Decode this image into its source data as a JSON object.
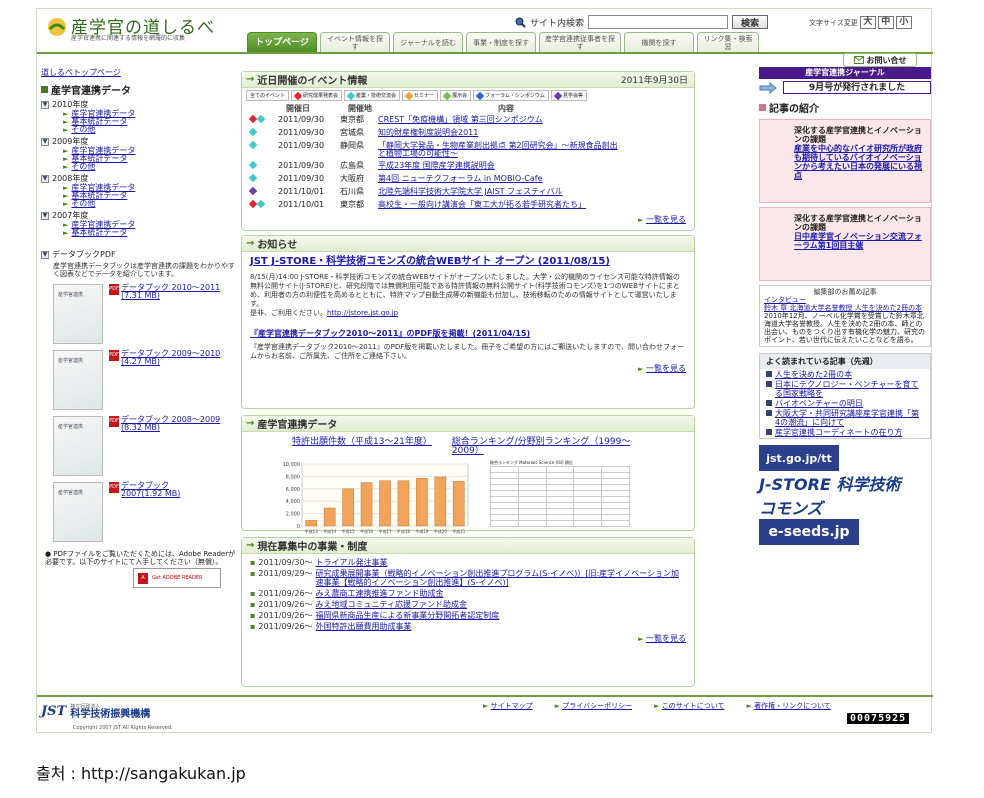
{
  "header": {
    "site_title": "産学官の道しるべ",
    "site_subtitle": "産学官連携に関連する情報を網羅的に収集",
    "search_label": "サイト内検索",
    "search_placeholder": "",
    "search_button": "検索",
    "fontsize_label": "文字サイズ変更",
    "fontsize_large": "大",
    "fontsize_medium": "中",
    "fontsize_small": "小",
    "inquiry": "お問い合せ"
  },
  "nav": [
    "トップページ",
    "イベント情報を探す",
    "ジャーナルを読む",
    "事業・制度を探す",
    "産学官連携従事者を探す",
    "機関を探す",
    "リンク集・検索窓"
  ],
  "left": {
    "breadcrumb": "道しるべトップページ",
    "data_heading": "産学官連携データ",
    "years": [
      {
        "year": "2010年度",
        "items": [
          "産学官連携データ",
          "基本統計データ",
          "その他"
        ]
      },
      {
        "year": "2009年度",
        "items": [
          "産学官連携データ",
          "基本統計データ",
          "その他"
        ]
      },
      {
        "year": "2008年度",
        "items": [
          "産学官連携データ",
          "基本統計データ",
          "その他"
        ]
      },
      {
        "year": "2007年度",
        "items": [
          "産学官連携データ",
          "基本統計データ"
        ]
      }
    ],
    "pdf_heading": "データブックPDF",
    "pdf_desc": "産学官連携データブックは産学官連携の課題をわかりやすく図表などでデータを紹介しています。",
    "books": [
      {
        "label": "データブック 2010～2011",
        "size": "(7.31 MB)"
      },
      {
        "label": "データブック 2009～2010",
        "size": "(4.27 MB)"
      },
      {
        "label": "データブック 2008～2009",
        "size": "(8.32 MB)"
      },
      {
        "label": "データブック",
        "size": "2007(1.92 MB)"
      }
    ],
    "adobe_note": "PDFファイルをご覧いただくためには、Adobe Readerが必要です。以下のサイトにて入手してください（無償）。",
    "adobe_btn": "Get ADOBE READER"
  },
  "events": {
    "title": "近日開催のイベント情報",
    "date": "2011年9月30日",
    "legend": [
      "全てのイベント",
      "研究成果発表会",
      "産業・技術交流会",
      "セミナー",
      "展示会",
      "フォーラム・シンポジウム",
      "見学会等"
    ],
    "col_date": "開催日",
    "col_place": "開催地",
    "col_content": "内容",
    "rows": [
      {
        "date": "2011/09/30",
        "place": "東京都",
        "title": "CREST「免疫機構」領域 第三回シンポジウム",
        "marks": [
          "#e0262c",
          "#3fc9c9"
        ]
      },
      {
        "date": "2011/09/30",
        "place": "宮城県",
        "title": "知的財産権制度説明会2011",
        "marks": [
          "#3fc9c9"
        ]
      },
      {
        "date": "2011/09/30",
        "place": "静岡県",
        "title": "「静岡大学発品・生物産業創出拠点 第2回研究会」～新規食品創出と植物工場の可能性～",
        "marks": [
          "#3fc9c9"
        ]
      },
      {
        "date": "2011/09/30",
        "place": "広島県",
        "title": "平成23年度 国際産学連携説明会",
        "marks": [
          "#3fc9c9"
        ]
      },
      {
        "date": "2011/09/30",
        "place": "大阪府",
        "title": "第4回 ニューテクフォーラム in MOBIO-Cafe",
        "marks": [
          "#3fc9c9"
        ]
      },
      {
        "date": "2011/10/01",
        "place": "石川県",
        "title": "北陸先端科学技術大学院大学 JAIST フェスティバル",
        "marks": [
          "#6a3fa8"
        ]
      },
      {
        "date": "2011/10/01",
        "place": "東京都",
        "title": "高校生・一般向け講演会「東工大が拓る若手研究者たち」",
        "marks": [
          "#e0262c",
          "#3fc9c9"
        ]
      }
    ],
    "more": "一覧を見る"
  },
  "news": {
    "title": "お知らせ",
    "item1_title": "JST J-STORE・科学技術コモンズの統合WEBサイト オープン (2011/08/15)",
    "item1_body": "8/15(月)14:00 J-STORE・科学技術コモンズの統合WEBサイトがオープンいたしました。大学・公的機関のライセンス可能な特許情報の無料公開サイト(J-STORE)と、研究段階では無償利用可能である特許情報の無料公開サイト(科学技術コモンズ)を1つのWEBサイトにまとめ、利用者の方の利便性を高めるとともに、特許マップ自動生成等の新機能も付加し、技術移転のための情報サイトとして運営いたします。",
    "item1_link_prefix": "是非、ご利用ください。",
    "item1_link": "http://jstore.jst.go.jp",
    "item2_title": "『産学官連携データブック2010～2011』のPDF版を掲載！(2011/04/15)",
    "item2_body": "『産学官連携データブック2010～2011』のPDF版を掲載いたしました。冊子をご希望の方にはご郵送いたしますので、問い合わせフォームからお名前、ご所属先、ご住所をご連絡下さい。",
    "more": "一覧を見る"
  },
  "renkei": {
    "title": "産学官連携データ",
    "link1": "特許出願件数（平成13～21年度）",
    "link2": "総合ランキング/分野別ランキング（1999～2009）",
    "rank_title": "総合ランキング Materials Science (ISI) 順位"
  },
  "chart_data": {
    "type": "bar",
    "title": "",
    "categories": [
      "平成13",
      "平成14",
      "平成15",
      "平成16",
      "平成17",
      "平成18",
      "平成19",
      "平成20",
      "平成21"
    ],
    "values": [
      900,
      2900,
      6000,
      7000,
      7300,
      7300,
      7700,
      7900,
      7200
    ],
    "ylim": [
      0,
      10000
    ],
    "yticks": [
      "10,000",
      "8,000",
      "6,000",
      "4,000",
      "2,000",
      "0"
    ],
    "bar_color": "#f2a45a"
  },
  "recruit": {
    "title": "現在募集中の事業・制度",
    "rows": [
      {
        "date": "2011/09/30～",
        "title": "トライアル発注事業"
      },
      {
        "date": "2011/09/29～",
        "title": "研究成果展開事業（戦略的イノベーション創出推進プログラム(S-イノベ)）[旧:産学イノベーション加速事業【戦略的イノベーション創出推進】(S-イノベ)]"
      },
      {
        "date": "2011/09/26～",
        "title": "みえ農商工連携推進ファンド助成金"
      },
      {
        "date": "2011/09/26～",
        "title": "みえ地域コミュニティ応援ファンド助成金"
      },
      {
        "date": "2011/09/26～",
        "title": "福岡県新商品生産による新事業分野開拓者認定制度"
      },
      {
        "date": "2011/09/26～",
        "title": "外国特許出願費用助成事業"
      }
    ],
    "more": "一覧を見る"
  },
  "right": {
    "journal_head": "産学官連携ジャーナル",
    "journal_issue": "9月号が発行されました",
    "articles_head": "記事の紹介",
    "pink1_title": "深化する産学官連携とイノベーションの課題",
    "pink1_link": "産業を中心的なバイオ研究所が政府も期待しているバイオイノベーションから考えたい日本の発展にいる視点",
    "pink2_title": "深化する産学官連携とイノベーションの課題",
    "pink2_link": "日中産学官イノベーション交流フォーラム第1回目主催",
    "rec_caption": "編集部のお薦め記事",
    "rec_label": "インタビュー",
    "rec_link": "鈴木 章 北海道大学名誉教授 人生を決めた2冊の本",
    "rec_body": "2010年12月、ノーベル化学賞を受賞した鈴木章北海道大学名誉教授。人生を決めた2冊の本、師との出会い、ものをつくり出す有機化学の魅力、研究のポイント、若い世代に伝えたいことなどを語る。",
    "pop_head": "よく読まれている記事（先週）",
    "pop_items": [
      "人生を決めた2冊の本",
      "日本にテクノロジー・ベンチャーを育てる国家戦略を",
      "バイオベンチャーの明日",
      "大阪大学・共同研究講座産学官連携「第4の潮流」に向けて",
      "産学官連携コーディネートの在り方"
    ],
    "banner1": "jst.go.jp/tt",
    "banner2": "J-STORE 科学技術コモンズ",
    "banner3": "e-seeds.jp"
  },
  "footer": {
    "org_small": "独立行政法人",
    "org_name": "科学技術振興機構",
    "copyright": "Copyright 2007 JST All Rights Reserved.",
    "links": [
      "サイトマップ",
      "プライバシーポリシー",
      "このサイトについて",
      "著作権・リンクについて"
    ],
    "counter": "00075925"
  },
  "source": "출처 : http://sangakukan.jp"
}
